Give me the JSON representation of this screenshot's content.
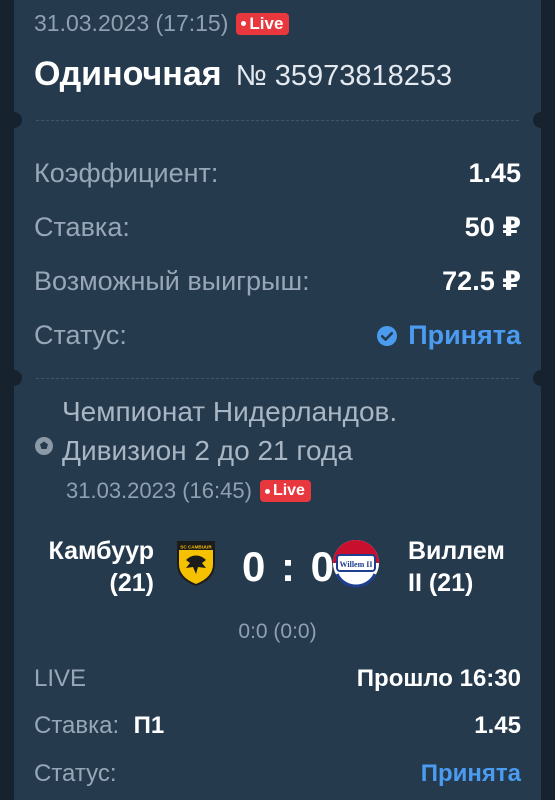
{
  "header": {
    "datetime": "31.03.2023 (17:15)",
    "live_badge": "Live",
    "title": "Одиночная",
    "bet_number": "№ 35973818253"
  },
  "summary": {
    "coefficient_label": "Коэффициент:",
    "coefficient_value": "1.45",
    "stake_label": "Ставка:",
    "stake_value": "50 ₽",
    "win_label": "Возможный выигрыш:",
    "win_value": "72.5 ₽",
    "status_label": "Статус:",
    "status_value": "Принята",
    "status_icon": "check-circle-icon"
  },
  "event": {
    "tournament_line1": "Чемпионат Нидерландов.",
    "tournament_line2": "Дивизион 2 до 21 года",
    "datetime": "31.03.2023 (16:45)",
    "live_badge": "Live",
    "home_team_line1": "Камбуур",
    "home_team_line2": "(21)",
    "away_team_line1": "Виллем",
    "away_team_line2": "II (21)",
    "score": "0 : 0",
    "sub_score": "0:0 (0:0)",
    "home_logo_text": "SC CAMBUUR",
    "away_logo_text": "Willem II"
  },
  "details": {
    "live_label": "LIVE",
    "elapsed": "Прошло 16:30",
    "stake_label": "Ставка:",
    "outcome": "П1",
    "coefficient": "1.45",
    "status_label": "Статус:",
    "status_value": "Принята"
  },
  "colors": {
    "background": "#16222e",
    "card": "#263a4e",
    "accent_blue": "#4b9bf0",
    "live_red": "#e8383d"
  }
}
